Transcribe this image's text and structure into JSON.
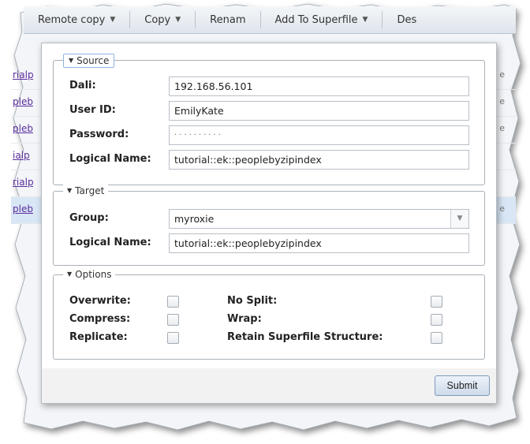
{
  "toolbar": {
    "items": [
      {
        "label": "Remote copy",
        "icon": "chevron-down-icon"
      },
      {
        "label": "Copy",
        "icon": "chevron-down-icon"
      },
      {
        "label": "Renam"
      },
      {
        "label": "Add To Superfile",
        "icon": "chevron-down-icon"
      },
      {
        "label": "Des"
      }
    ]
  },
  "background_rows": [
    {
      "link": "rialp",
      "right": "e"
    },
    {
      "link": "pleb",
      "right": "e"
    },
    {
      "link": "pleb",
      "right": "e"
    },
    {
      "link": "ialp",
      "right": ""
    },
    {
      "link": "rialp",
      "right": ""
    },
    {
      "link": "pleb",
      "right": "e"
    }
  ],
  "source": {
    "legend": "Source",
    "dali_label": "Dali:",
    "dali_value": "192.168.56.101",
    "userid_label": "User ID:",
    "userid_value": "EmilyKate",
    "password_label": "Password:",
    "password_value": "··········",
    "logical_label": "Logical Name:",
    "logical_value": "tutorial::ek::peoplebyzipindex"
  },
  "target": {
    "legend": "Target",
    "group_label": "Group:",
    "group_value": "myroxie",
    "logical_label": "Logical Name:",
    "logical_value": "tutorial::ek::peoplebyzipindex"
  },
  "options": {
    "legend": "Options",
    "overwrite": "Overwrite:",
    "compress": "Compress:",
    "replicate": "Replicate:",
    "nosplit": "No Split:",
    "wrap": "Wrap:",
    "retain": "Retain Superfile Structure:"
  },
  "submit_label": "Submit",
  "colors": {
    "accent": "#8fb3e0",
    "selected_row": "#d8e6f6",
    "link": "#5a2d9c"
  }
}
